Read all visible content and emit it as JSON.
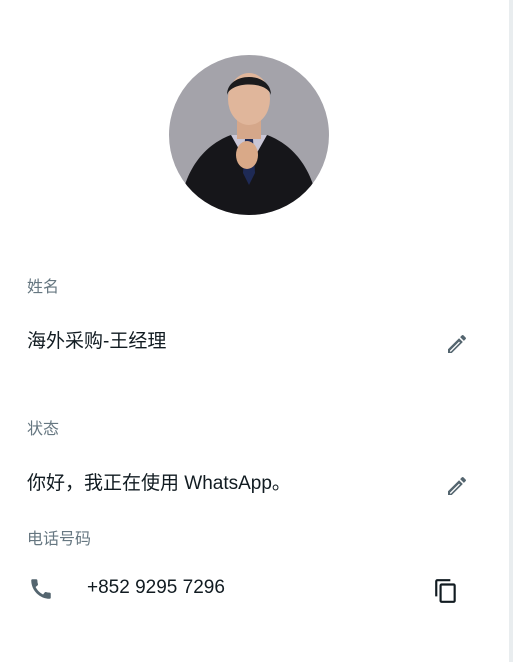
{
  "profile": {
    "name_label": "姓名",
    "name_value": "海外采购-王经理",
    "status_label": "状态",
    "status_value": "你好，我正在使用 WhatsApp。",
    "phone_label": "电话号码",
    "phone_value": "+852 9295 7296"
  },
  "icons": {
    "edit_name": "pencil-icon",
    "edit_status": "pencil-icon",
    "phone": "phone-icon",
    "copy": "copy-icon"
  },
  "colors": {
    "label": "#667781",
    "text": "#111b21",
    "icon": "#54656f",
    "background": "#ffffff"
  }
}
